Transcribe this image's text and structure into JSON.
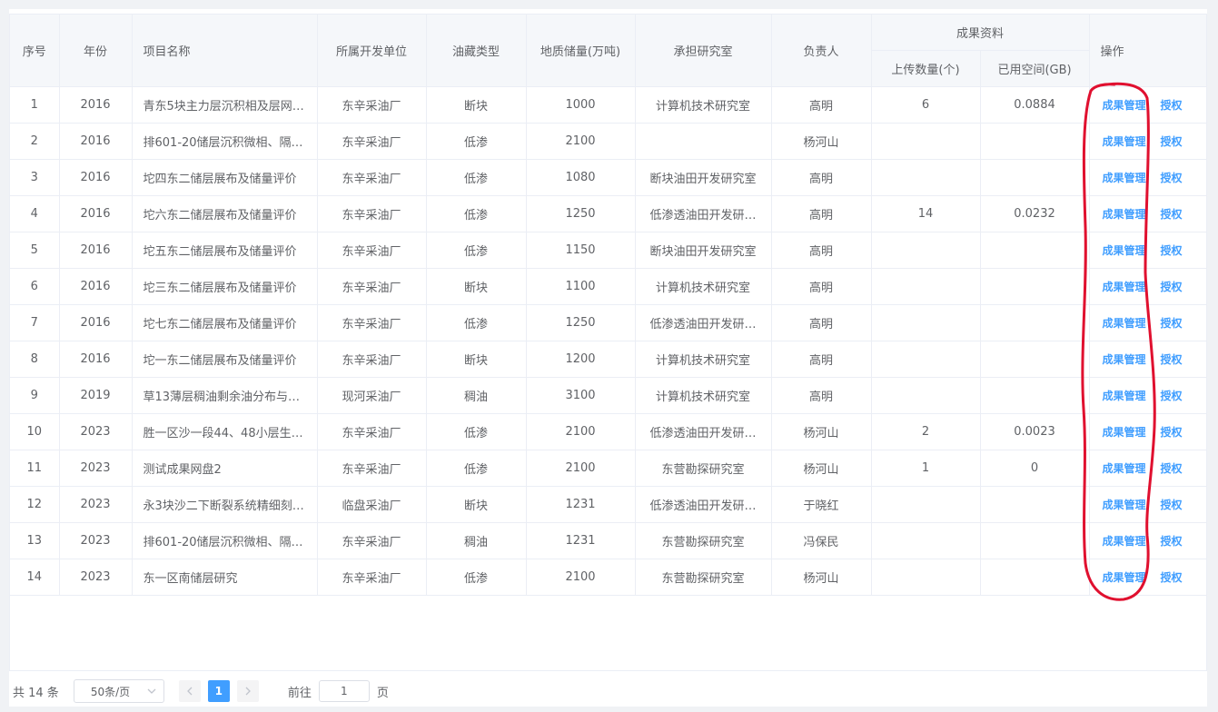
{
  "table": {
    "headers": {
      "index": "序号",
      "year": "年份",
      "project": "项目名称",
      "unit": "所属开发单位",
      "reservoir": "油藏类型",
      "reserves": "地质储量(万吨)",
      "lab": "承担研究室",
      "owner": "负责人",
      "results_group": "成果资料",
      "upload_count": "上传数量(个)",
      "used_space": "已用空间(GB)",
      "ops": "操作"
    },
    "rows": [
      {
        "idx": "1",
        "year": "2016",
        "project": "青东5块主力层沉积相及层网…",
        "unit": "东辛采油厂",
        "reservoir": "断块",
        "reserves": "1000",
        "lab": "计算机技术研究室",
        "owner": "高明",
        "count": "6",
        "space": "0.0884"
      },
      {
        "idx": "2",
        "year": "2016",
        "project": "排601-20储层沉积微相、隔…",
        "unit": "东辛采油厂",
        "reservoir": "低渗",
        "reserves": "2100",
        "lab": "",
        "owner": "杨河山",
        "count": "",
        "space": ""
      },
      {
        "idx": "3",
        "year": "2016",
        "project": "坨四东二储层展布及储量评价",
        "unit": "东辛采油厂",
        "reservoir": "低渗",
        "reserves": "1080",
        "lab": "断块油田开发研究室",
        "owner": "高明",
        "count": "",
        "space": ""
      },
      {
        "idx": "4",
        "year": "2016",
        "project": "坨六东二储层展布及储量评价",
        "unit": "东辛采油厂",
        "reservoir": "低渗",
        "reserves": "1250",
        "lab": "低渗透油田开发研…",
        "owner": "高明",
        "count": "14",
        "space": "0.0232"
      },
      {
        "idx": "5",
        "year": "2016",
        "project": "坨五东二储层展布及储量评价",
        "unit": "东辛采油厂",
        "reservoir": "低渗",
        "reserves": "1150",
        "lab": "断块油田开发研究室",
        "owner": "高明",
        "count": "",
        "space": ""
      },
      {
        "idx": "6",
        "year": "2016",
        "project": "坨三东二储层展布及储量评价",
        "unit": "东辛采油厂",
        "reservoir": "断块",
        "reserves": "1100",
        "lab": "计算机技术研究室",
        "owner": "高明",
        "count": "",
        "space": ""
      },
      {
        "idx": "7",
        "year": "2016",
        "project": "坨七东二储层展布及储量评价",
        "unit": "东辛采油厂",
        "reservoir": "低渗",
        "reserves": "1250",
        "lab": "低渗透油田开发研…",
        "owner": "高明",
        "count": "",
        "space": ""
      },
      {
        "idx": "8",
        "year": "2016",
        "project": "坨一东二储层展布及储量评价",
        "unit": "东辛采油厂",
        "reservoir": "断块",
        "reserves": "1200",
        "lab": "计算机技术研究室",
        "owner": "高明",
        "count": "",
        "space": ""
      },
      {
        "idx": "9",
        "year": "2019",
        "project": "草13薄层稠油剩余油分布与…",
        "unit": "现河采油厂",
        "reservoir": "稠油",
        "reserves": "3100",
        "lab": "计算机技术研究室",
        "owner": "高明",
        "count": "",
        "space": ""
      },
      {
        "idx": "10",
        "year": "2023",
        "project": "胜一区沙一段44、48小层生…",
        "unit": "东辛采油厂",
        "reservoir": "低渗",
        "reserves": "2100",
        "lab": "低渗透油田开发研…",
        "owner": "杨河山",
        "count": "2",
        "space": "0.0023"
      },
      {
        "idx": "11",
        "year": "2023",
        "project": "测试成果网盘2",
        "unit": "东辛采油厂",
        "reservoir": "低渗",
        "reserves": "2100",
        "lab": "东营勘探研究室",
        "owner": "杨河山",
        "count": "1",
        "space": "0"
      },
      {
        "idx": "12",
        "year": "2023",
        "project": "永3块沙二下断裂系统精细刻…",
        "unit": "临盘采油厂",
        "reservoir": "断块",
        "reserves": "1231",
        "lab": "低渗透油田开发研…",
        "owner": "于晓红",
        "count": "",
        "space": ""
      },
      {
        "idx": "13",
        "year": "2023",
        "project": "排601-20储层沉积微相、隔…",
        "unit": "东辛采油厂",
        "reservoir": "稠油",
        "reserves": "1231",
        "lab": "东营勘探研究室",
        "owner": "冯保民",
        "count": "",
        "space": ""
      },
      {
        "idx": "14",
        "year": "2023",
        "project": "东一区南储层研究",
        "unit": "东辛采油厂",
        "reservoir": "低渗",
        "reserves": "2100",
        "lab": "东营勘探研究室",
        "owner": "杨河山",
        "count": "",
        "space": ""
      }
    ],
    "actions": {
      "manage": "成果管理",
      "authorize": "授权"
    }
  },
  "pagination": {
    "total": "共 14 条",
    "page_size": "50条/页",
    "current_page": "1",
    "goto_prefix": "前往",
    "goto_value": "1",
    "goto_suffix": "页",
    "prev_icon": "chevron-left-icon",
    "next_icon": "chevron-right-icon"
  },
  "colors": {
    "accent": "#409eff",
    "annotation": "#e0102f",
    "header_bg": "#f5f7fa",
    "border": "#ebeef5"
  }
}
